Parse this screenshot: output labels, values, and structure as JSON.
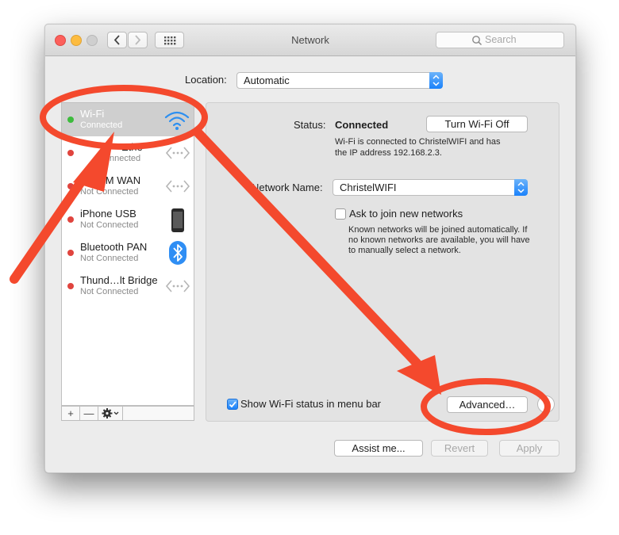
{
  "window": {
    "title": "Network",
    "search_placeholder": "Search"
  },
  "location": {
    "label": "Location:",
    "value": "Automatic"
  },
  "services": [
    {
      "name": "Wi-Fi",
      "status": "Connected",
      "dot_color": "#3dbb3d",
      "icon": "wifi-icon"
    },
    {
      "name": "Ethe",
      "status": "nnected",
      "dot_color": "#e0443e",
      "icon": "ethernet-icon"
    },
    {
      "name": "ul505M WAN",
      "status": "Not Connected",
      "dot_color": "#e0443e",
      "icon": "ethernet-icon"
    },
    {
      "name": "iPhone USB",
      "status": "Not Connected",
      "dot_color": "#e0443e",
      "icon": "iphone-icon"
    },
    {
      "name": "Bluetooth PAN",
      "status": "Not Connected",
      "dot_color": "#e0443e",
      "icon": "bluetooth-icon"
    },
    {
      "name": "Thund…lt Bridge",
      "status": "Not Connected",
      "dot_color": "#e0443e",
      "icon": "ethernet-icon"
    }
  ],
  "sidebar_buttons": {
    "add": "+",
    "remove": "—"
  },
  "detail": {
    "status_label": "Status:",
    "status_value": "Connected",
    "turn_off_label": "Turn Wi-Fi Off",
    "status_desc_1": "Wi-Fi is connected to ChristelWIFI and has",
    "status_desc_2": "the IP address 192.168.2.3.",
    "network_name_label": "Network Name:",
    "network_name_value": "ChristelWIFI",
    "ask_join_label": "Ask to join new networks",
    "ask_join_checked": false,
    "ask_desc_1": "Known networks will be joined automatically. If",
    "ask_desc_2": "no known networks are available, you will have",
    "ask_desc_3": "to manually select a network.",
    "show_status_label": "Show Wi-Fi status in menu bar",
    "show_status_checked": true,
    "advanced_label": "Advanced…",
    "help_label": "?"
  },
  "footer": {
    "assist_label": "Assist me...",
    "revert_label": "Revert",
    "apply_label": "Apply"
  },
  "colors": {
    "annotation": "#f4492d",
    "accent": "#1a82fb"
  }
}
